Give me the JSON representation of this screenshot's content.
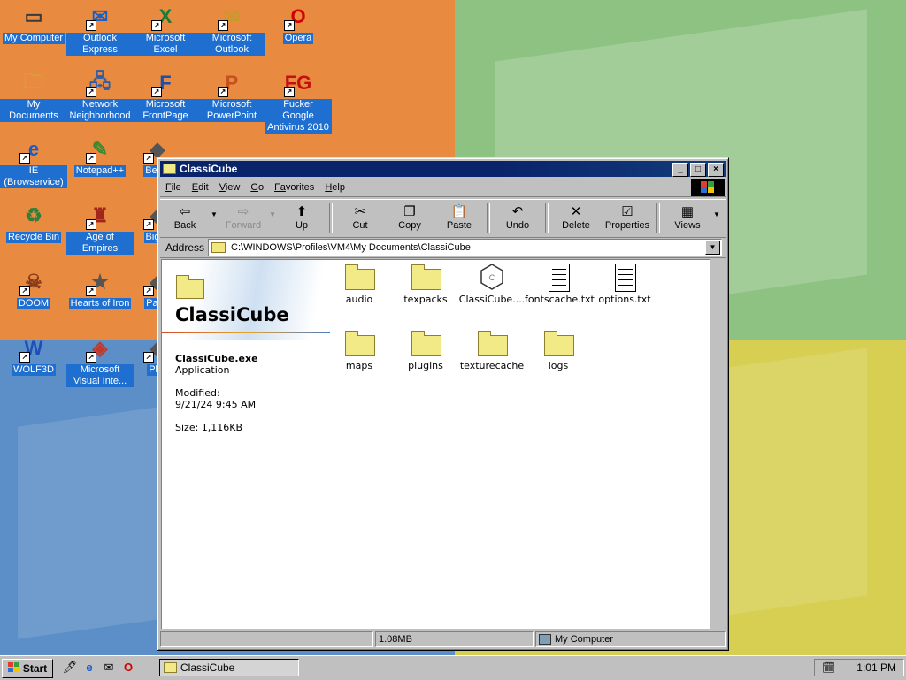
{
  "desktop": {
    "icons": [
      {
        "label": "My Computer",
        "icon": "computer-icon"
      },
      {
        "label": "Outlook Express",
        "icon": "outlook-express-icon"
      },
      {
        "label": "Microsoft Excel",
        "icon": "excel-icon"
      },
      {
        "label": "Microsoft Outlook",
        "icon": "outlook-icon"
      },
      {
        "label": "Opera",
        "icon": "opera-icon"
      },
      {
        "label": "My Documents",
        "icon": "documents-folder-icon"
      },
      {
        "label": "Network Neighborhood",
        "icon": "network-icon"
      },
      {
        "label": "Microsoft FrontPage",
        "icon": "frontpage-icon"
      },
      {
        "label": "Microsoft PowerPoint",
        "icon": "powerpoint-icon"
      },
      {
        "label": "Fucker Google Antivirus 2010",
        "icon": "antivirus-icon"
      },
      {
        "label": "IE (Browservice)",
        "icon": "internet-explorer-icon"
      },
      {
        "label": "Notepad++",
        "icon": "notepad-plus-icon"
      },
      {
        "label": "Recycle Bin",
        "icon": "recycle-bin-icon"
      },
      {
        "label": "Age of Empires",
        "icon": "age-of-empires-icon"
      },
      {
        "label": "DOOM",
        "icon": "doom-icon"
      },
      {
        "label": "Hearts of Iron",
        "icon": "hearts-of-iron-icon"
      },
      {
        "label": "Pagg",
        "icon": "app-icon"
      },
      {
        "label": "WOLF3D",
        "icon": "wolf3d-icon"
      },
      {
        "label": "Microsoft Visual Inte...",
        "icon": "visual-interdev-icon"
      },
      {
        "label": "Bet D",
        "icon": "app-icon"
      },
      {
        "label": "Big D",
        "icon": "app-icon"
      },
      {
        "label": "Pl Z",
        "icon": "app-icon"
      }
    ]
  },
  "window": {
    "title": "ClassiCube",
    "menu": [
      {
        "key": "F",
        "rest": "ile"
      },
      {
        "key": "E",
        "rest": "dit"
      },
      {
        "key": "V",
        "rest": "iew"
      },
      {
        "key": "G",
        "rest": "o"
      },
      {
        "key": "Fa",
        "rest": "vorites"
      },
      {
        "key": "H",
        "rest": "elp"
      }
    ],
    "toolbar": {
      "back": "Back",
      "forward": "Forward",
      "up": "Up",
      "cut": "Cut",
      "copy": "Copy",
      "paste": "Paste",
      "undo": "Undo",
      "delete": "Delete",
      "properties": "Properties",
      "views": "Views"
    },
    "address": {
      "label": "Address",
      "path": "C:\\WINDOWS\\Profiles\\VM4\\My Documents\\ClassiCube"
    },
    "panel": {
      "title": "ClassiCube",
      "filename": "ClassiCube.exe",
      "type": "Application",
      "modified_label": "Modified:",
      "modified_value": "9/21/24 9:45 AM",
      "size": "Size: 1,116KB"
    },
    "files": [
      {
        "name": "audio",
        "kind": "folder"
      },
      {
        "name": "texpacks",
        "kind": "folder"
      },
      {
        "name": "ClassiCube....",
        "kind": "exe"
      },
      {
        "name": "fontscache.txt",
        "kind": "text"
      },
      {
        "name": "options.txt",
        "kind": "text"
      },
      {
        "name": "maps",
        "kind": "folder"
      },
      {
        "name": "plugins",
        "kind": "folder"
      },
      {
        "name": "texturecache",
        "kind": "folder"
      },
      {
        "name": "logs",
        "kind": "folder"
      }
    ],
    "status": {
      "size": "1.08MB",
      "location": "My Computer"
    }
  },
  "taskbar": {
    "start": "Start",
    "task": "ClassiCube",
    "clock": "1:01 PM"
  }
}
